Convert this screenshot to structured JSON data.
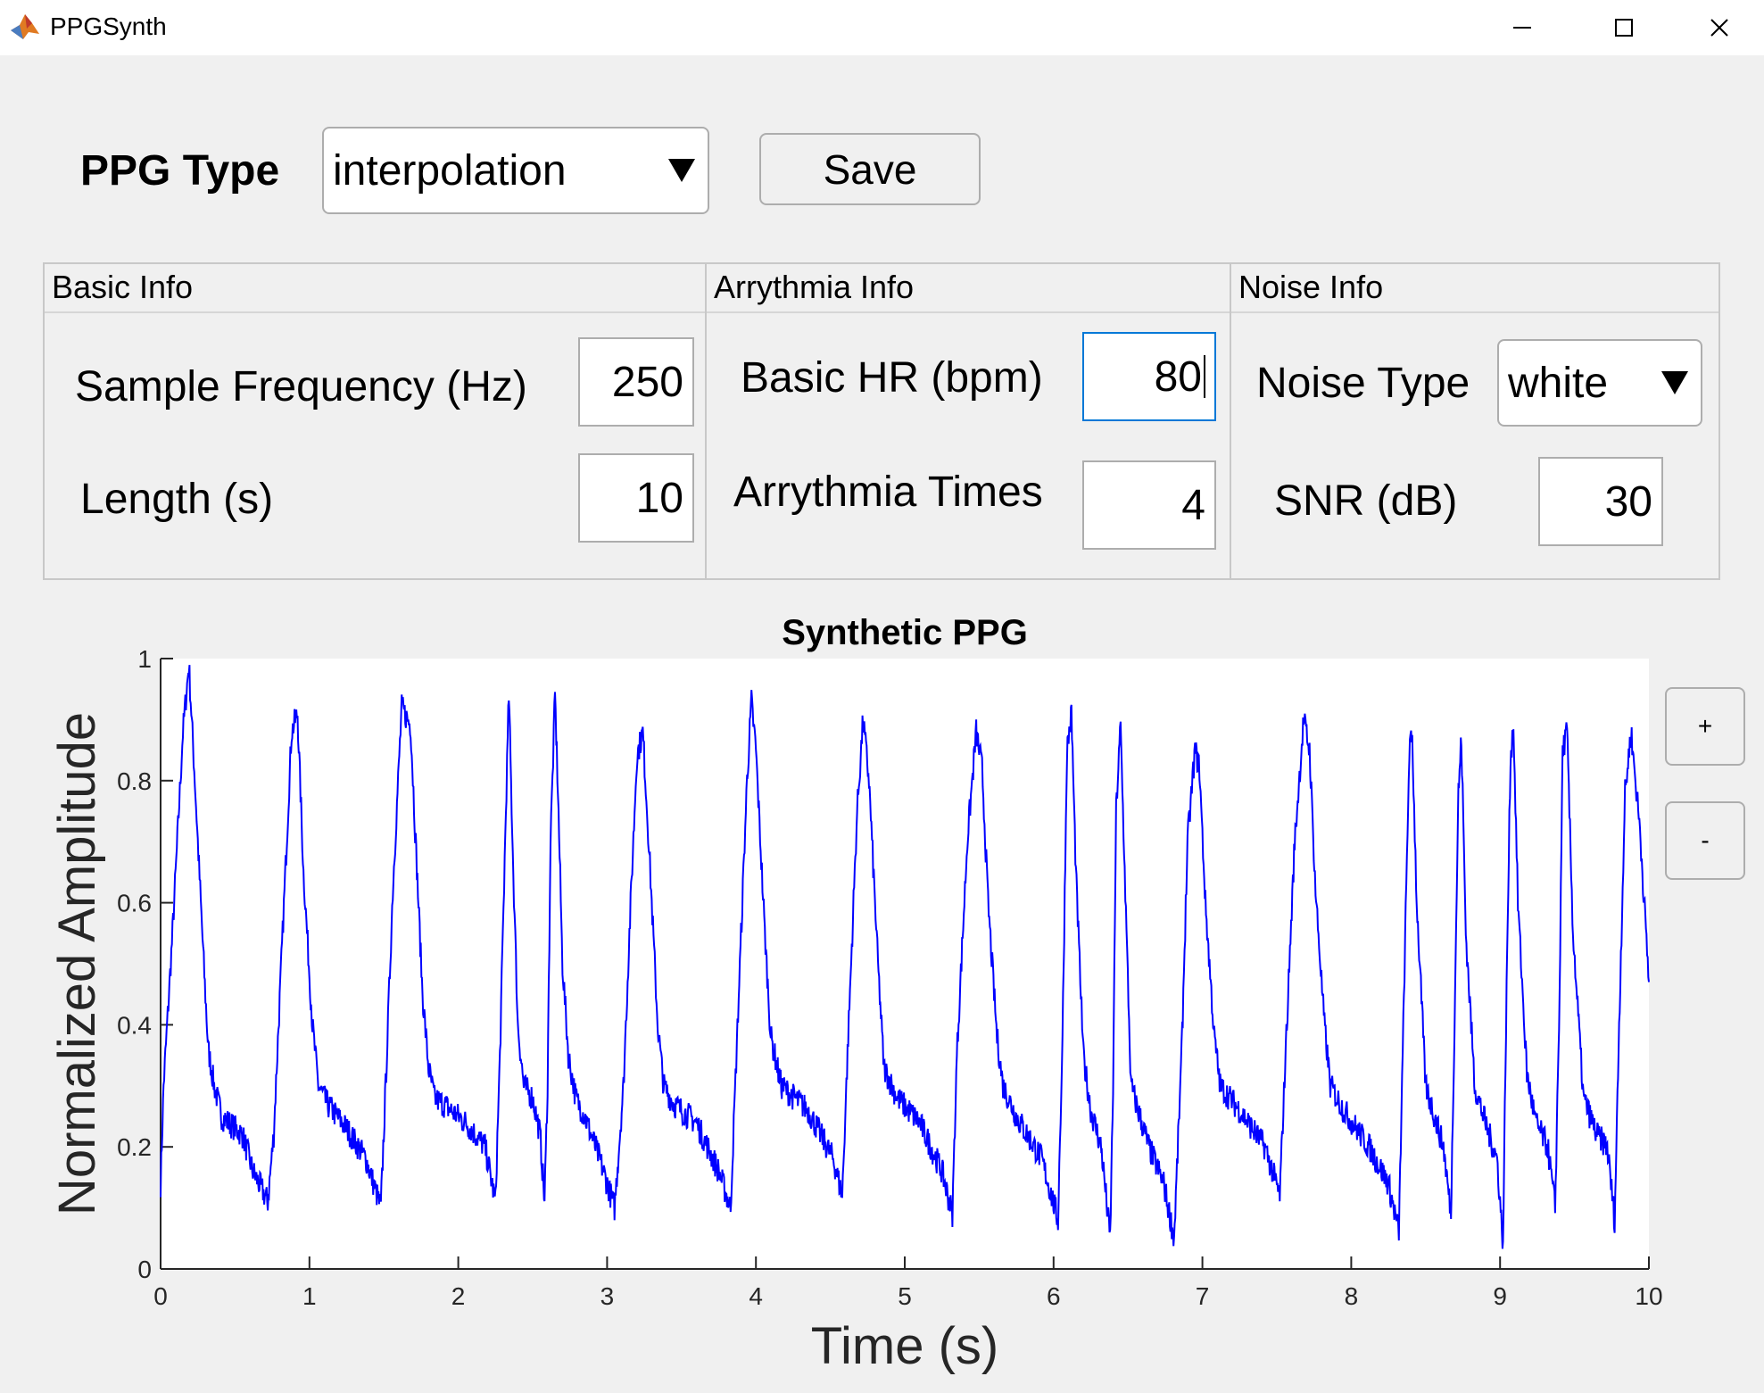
{
  "window": {
    "title": "PPGSynth"
  },
  "toolbar": {
    "ppg_type_label": "PPG Type",
    "ppg_type_value": "interpolation",
    "save_label": "Save"
  },
  "panels": {
    "basic": {
      "title": "Basic Info",
      "sample_frequency_label": "Sample Frequency (Hz)",
      "sample_frequency_value": "250",
      "length_label": "Length (s)",
      "length_value": "10"
    },
    "arrythmia": {
      "title": "Arrythmia Info",
      "basic_hr_label": "Basic HR (bpm)",
      "basic_hr_value": "80",
      "times_label": "Arrythmia Times",
      "times_value": "4"
    },
    "noise": {
      "title": "Noise Info",
      "noise_type_label": "Noise Type",
      "noise_type_value": "white",
      "snr_label": "SNR (dB)",
      "snr_value": "30"
    }
  },
  "zoom": {
    "plus_label": "+",
    "minus_label": "-"
  },
  "colors": {
    "line": "#0000ff",
    "focus": "#0078d7"
  },
  "chart_data": {
    "type": "line",
    "title": "Synthetic PPG",
    "xlabel": "Time (s)",
    "ylabel": "Normalized Amplitude",
    "xlim": [
      0,
      10
    ],
    "ylim": [
      0,
      1
    ],
    "xticks": [
      0,
      1,
      2,
      3,
      4,
      5,
      6,
      7,
      8,
      9,
      10
    ],
    "yticks": [
      0,
      0.2,
      0.4,
      0.6,
      0.8,
      1
    ],
    "grid": false,
    "series": [
      {
        "color": "#0000ff",
        "x": [
          0.0,
          0.02,
          0.08,
          0.15,
          0.19,
          0.23,
          0.29,
          0.32,
          0.36,
          0.41,
          0.55,
          0.62,
          0.72,
          0.76,
          0.82,
          0.88,
          0.92,
          0.96,
          1.02,
          1.06,
          1.12,
          1.25,
          1.38,
          1.48,
          1.52,
          1.56,
          1.62,
          1.68,
          1.71,
          1.76,
          1.8,
          1.84,
          1.9,
          2.05,
          2.18,
          2.25,
          2.28,
          2.32,
          2.34,
          2.37,
          2.4,
          2.44,
          2.5,
          2.55,
          2.58,
          2.6,
          2.62,
          2.65,
          2.67,
          2.7,
          2.74,
          2.79,
          2.85,
          2.95,
          3.05,
          3.11,
          3.15,
          3.2,
          3.24,
          3.28,
          3.34,
          3.38,
          3.45,
          3.6,
          3.75,
          3.83,
          3.88,
          3.94,
          3.97,
          4.0,
          4.06,
          4.1,
          4.17,
          4.35,
          4.52,
          4.58,
          4.62,
          4.68,
          4.72,
          4.76,
          4.82,
          4.86,
          4.95,
          5.1,
          5.25,
          5.32,
          5.35,
          5.42,
          5.48,
          5.52,
          5.56,
          5.62,
          5.66,
          5.75,
          5.92,
          6.03,
          6.06,
          6.09,
          6.12,
          6.15,
          6.2,
          6.25,
          6.32,
          6.38,
          6.4,
          6.42,
          6.45,
          6.49,
          6.52,
          6.58,
          6.64,
          6.74,
          6.81,
          6.86,
          6.9,
          6.95,
          6.98,
          7.02,
          7.08,
          7.12,
          7.25,
          7.42,
          7.52,
          7.56,
          7.62,
          7.68,
          7.72,
          7.76,
          7.82,
          7.86,
          7.95,
          8.12,
          8.25,
          8.32,
          8.35,
          8.39,
          8.41,
          8.44,
          8.5,
          8.56,
          8.62,
          8.67,
          8.69,
          8.72,
          8.74,
          8.77,
          8.83,
          8.9,
          8.98,
          9.02,
          9.04,
          9.07,
          9.09,
          9.12,
          9.18,
          9.24,
          9.32,
          9.37,
          9.4,
          9.42,
          9.45,
          9.49,
          9.56,
          9.65,
          9.72,
          9.77,
          9.8,
          9.84,
          9.88,
          9.94,
          10.0
        ],
        "y": [
          0.14,
          0.3,
          0.55,
          0.88,
          0.99,
          0.8,
          0.5,
          0.36,
          0.3,
          0.25,
          0.22,
          0.16,
          0.11,
          0.22,
          0.55,
          0.88,
          0.91,
          0.65,
          0.4,
          0.3,
          0.27,
          0.23,
          0.18,
          0.1,
          0.35,
          0.62,
          0.92,
          0.89,
          0.72,
          0.45,
          0.33,
          0.28,
          0.27,
          0.24,
          0.2,
          0.11,
          0.35,
          0.75,
          0.94,
          0.65,
          0.4,
          0.3,
          0.28,
          0.22,
          0.11,
          0.3,
          0.7,
          0.94,
          0.78,
          0.5,
          0.35,
          0.28,
          0.25,
          0.18,
          0.1,
          0.3,
          0.55,
          0.84,
          0.88,
          0.7,
          0.4,
          0.3,
          0.27,
          0.24,
          0.16,
          0.1,
          0.42,
          0.8,
          0.93,
          0.85,
          0.55,
          0.38,
          0.3,
          0.26,
          0.18,
          0.12,
          0.38,
          0.75,
          0.9,
          0.8,
          0.5,
          0.33,
          0.28,
          0.24,
          0.16,
          0.09,
          0.35,
          0.7,
          0.88,
          0.82,
          0.6,
          0.38,
          0.3,
          0.25,
          0.18,
          0.08,
          0.38,
          0.85,
          0.91,
          0.65,
          0.35,
          0.26,
          0.2,
          0.05,
          0.3,
          0.75,
          0.89,
          0.55,
          0.3,
          0.25,
          0.2,
          0.14,
          0.05,
          0.35,
          0.7,
          0.85,
          0.82,
          0.6,
          0.38,
          0.3,
          0.26,
          0.2,
          0.12,
          0.36,
          0.7,
          0.9,
          0.85,
          0.62,
          0.4,
          0.3,
          0.26,
          0.2,
          0.14,
          0.06,
          0.4,
          0.85,
          0.87,
          0.6,
          0.3,
          0.25,
          0.2,
          0.09,
          0.35,
          0.78,
          0.87,
          0.55,
          0.3,
          0.24,
          0.18,
          0.04,
          0.4,
          0.84,
          0.89,
          0.6,
          0.32,
          0.24,
          0.2,
          0.1,
          0.45,
          0.85,
          0.88,
          0.55,
          0.28,
          0.22,
          0.2,
          0.08,
          0.4,
          0.78,
          0.88,
          0.72,
          0.47
        ]
      }
    ]
  }
}
